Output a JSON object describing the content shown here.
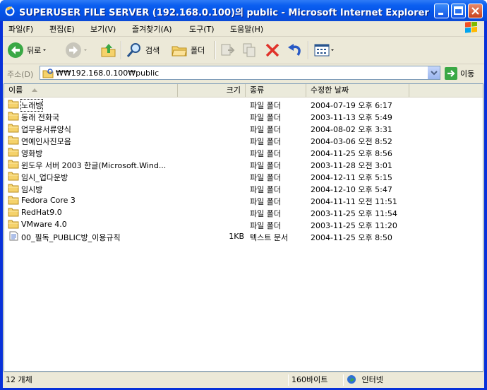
{
  "window": {
    "title": "SUPERUSER FILE SERVER (192.168.0.100)의 public - Microsoft Internet Explorer"
  },
  "menu": [
    {
      "label": "파일(F)"
    },
    {
      "label": "편집(E)"
    },
    {
      "label": "보기(V)"
    },
    {
      "label": "즐겨찾기(A)"
    },
    {
      "label": "도구(T)"
    },
    {
      "label": "도움말(H)"
    }
  ],
  "toolbar": {
    "back_label": "뒤로",
    "search_label": "검색",
    "folders_label": "폴더"
  },
  "address": {
    "label": "주소(D)",
    "value": "₩₩192.168.0.100₩public",
    "go_label": "이동"
  },
  "columns": {
    "name": "이름",
    "size": "크기",
    "type": "종류",
    "modified": "수정한 날짜"
  },
  "files": [
    {
      "name": "노래방",
      "size": "",
      "type": "파일 폴더",
      "modified": "2004-07-19 오후 6:17",
      "icon": "folder-icon"
    },
    {
      "name": "동래 전화국",
      "size": "",
      "type": "파일 폴더",
      "modified": "2003-11-13 오후 5:49",
      "icon": "folder-icon"
    },
    {
      "name": "업무용서류양식",
      "size": "",
      "type": "파일 폴더",
      "modified": "2004-08-02 오후 3:31",
      "icon": "folder-icon"
    },
    {
      "name": "연예인사진모음",
      "size": "",
      "type": "파일 폴더",
      "modified": "2004-03-06 오전 8:52",
      "icon": "folder-icon"
    },
    {
      "name": "영화방",
      "size": "",
      "type": "파일 폴더",
      "modified": "2004-11-25 오후 8:56",
      "icon": "folder-icon"
    },
    {
      "name": "윈도우 서버 2003 한글(Microsoft.Wind...",
      "size": "",
      "type": "파일 폴더",
      "modified": "2003-11-28 오전 3:01",
      "icon": "folder-icon"
    },
    {
      "name": "임시_업다운방",
      "size": "",
      "type": "파일 폴더",
      "modified": "2004-12-11 오후 5:15",
      "icon": "folder-icon"
    },
    {
      "name": "임시방",
      "size": "",
      "type": "파일 폴더",
      "modified": "2004-12-10 오후 5:47",
      "icon": "folder-icon"
    },
    {
      "name": "Fedora Core 3",
      "size": "",
      "type": "파일 폴더",
      "modified": "2004-11-11 오전 11:51",
      "icon": "folder-icon"
    },
    {
      "name": "RedHat9.0",
      "size": "",
      "type": "파일 폴더",
      "modified": "2003-11-25 오후 11:54",
      "icon": "folder-icon"
    },
    {
      "name": "VMware 4.0",
      "size": "",
      "type": "파일 폴더",
      "modified": "2003-11-25 오후 11:20",
      "icon": "folder-icon"
    },
    {
      "name": "00_필독_PUBLIC방_이용규칙",
      "size": "1KB",
      "type": "텍스트 문서",
      "modified": "2004-11-25 오후 8:50",
      "icon": "text-file-icon"
    }
  ],
  "status": {
    "count": "12 개체",
    "size": "160바이트",
    "zone": "인터넷"
  },
  "colors": {
    "title_bar": "#0453e8",
    "chrome": "#ece9d8",
    "folder": "#f5d26b"
  }
}
